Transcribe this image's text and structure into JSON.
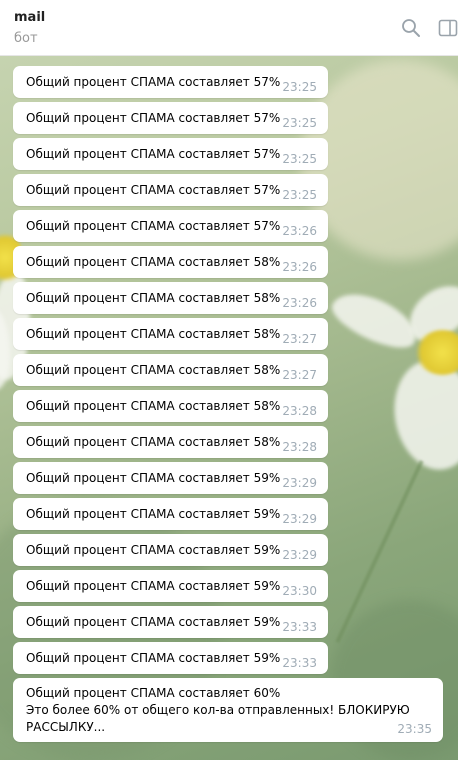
{
  "header": {
    "title": "mail",
    "status": "бот",
    "icons": [
      "search-icon",
      "sidebar-toggle-icon"
    ]
  },
  "messages": [
    {
      "text": "Общий процент СПАМА составляет 57%",
      "time": "23:25"
    },
    {
      "text": "Общий процент СПАМА составляет 57%",
      "time": "23:25"
    },
    {
      "text": "Общий процент СПАМА составляет 57%",
      "time": "23:25"
    },
    {
      "text": "Общий процент СПАМА составляет 57%",
      "time": "23:25"
    },
    {
      "text": "Общий процент СПАМА составляет 57%",
      "time": "23:26"
    },
    {
      "text": "Общий процент СПАМА составляет 58%",
      "time": "23:26"
    },
    {
      "text": "Общий процент СПАМА составляет 58%",
      "time": "23:26"
    },
    {
      "text": "Общий процент СПАМА составляет 58%",
      "time": "23:27"
    },
    {
      "text": "Общий процент СПАМА составляет 58%",
      "time": "23:27"
    },
    {
      "text": "Общий процент СПАМА составляет 58%",
      "time": "23:28"
    },
    {
      "text": "Общий процент СПАМА составляет 58%",
      "time": "23:28"
    },
    {
      "text": "Общий процент СПАМА составляет 59%",
      "time": "23:29"
    },
    {
      "text": "Общий процент СПАМА составляет 59%",
      "time": "23:29"
    },
    {
      "text": "Общий процент СПАМА составляет 59%",
      "time": "23:29"
    },
    {
      "text": "Общий процент СПАМА составляет 59%",
      "time": "23:30"
    },
    {
      "text": "Общий процент СПАМА составляет 59%",
      "time": "23:33"
    },
    {
      "text": "Общий процент СПАМА составляет 59%",
      "time": "23:33"
    }
  ],
  "final_message": {
    "lines": [
      "Общий процент СПАМА составляет 60%",
      "Это более 60% от общего кол-ва отправленных! БЛОКИРУЮ",
      "РАССЫЛКУ..."
    ],
    "time": "23:35"
  }
}
